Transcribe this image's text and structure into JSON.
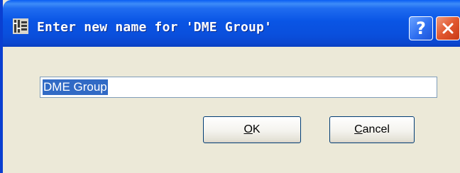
{
  "dialog": {
    "title": "Enter new name for 'DME Group'",
    "help_glyph": "?",
    "icon": "dme-app-icon"
  },
  "name_field": {
    "value": "DME Group",
    "selected": true
  },
  "buttons": {
    "ok": {
      "accel": "O",
      "rest": "K"
    },
    "cancel": {
      "accel": "C",
      "rest": "ancel"
    }
  },
  "colors": {
    "titlebar": "#0a55e5",
    "dialog_bg": "#ece9d8",
    "close_button": "#e1572e",
    "selection": "#316ac5"
  }
}
